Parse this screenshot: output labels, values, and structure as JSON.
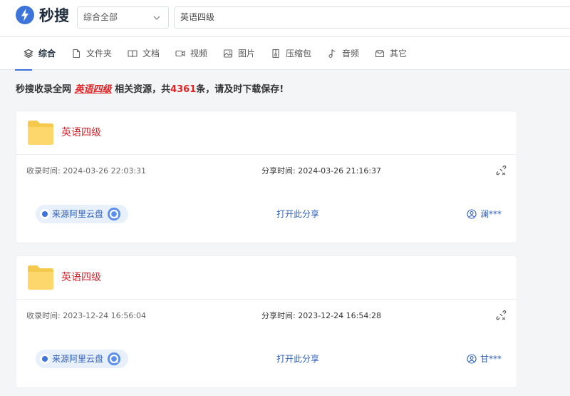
{
  "header": {
    "brand": "秒搜",
    "category_select": {
      "value": "综合全部"
    },
    "search": {
      "value": "英语四级"
    }
  },
  "tabs": [
    {
      "label": "综合",
      "icon": "layers-icon",
      "active": true
    },
    {
      "label": "文件夹",
      "icon": "file-icon",
      "active": false
    },
    {
      "label": "文档",
      "icon": "book-icon",
      "active": false
    },
    {
      "label": "视频",
      "icon": "video-icon",
      "active": false
    },
    {
      "label": "图片",
      "icon": "image-icon",
      "active": false
    },
    {
      "label": "压缩包",
      "icon": "zip-icon",
      "active": false
    },
    {
      "label": "音频",
      "icon": "music-icon",
      "active": false
    },
    {
      "label": "其它",
      "icon": "box-icon",
      "active": false
    }
  ],
  "summary": {
    "prefix": "秒搜收录全网 ",
    "keyword": "英语四级",
    "middle": " 相关资源，共",
    "count": "4361",
    "suffix": "条，请及时下载保存!"
  },
  "results": [
    {
      "title": "英语四级",
      "collected": "收录时间: 2024-03-26 22:03:31",
      "shared": "分享时间: 2024-03-26 21:16:37",
      "source": "来源阿里云盘",
      "open": "打开此分享",
      "user": "澜***"
    },
    {
      "title": "英语四级",
      "collected": "收录时间: 2023-12-24 16:56:04",
      "shared": "分享时间: 2023-12-24 16:54:28",
      "source": "来源阿里云盘",
      "open": "打开此分享",
      "user": "甘***"
    }
  ],
  "colors": {
    "accent": "#3d74d9",
    "keyword": "#e02424",
    "title": "#d4242e",
    "link": "#2f5fb8"
  }
}
